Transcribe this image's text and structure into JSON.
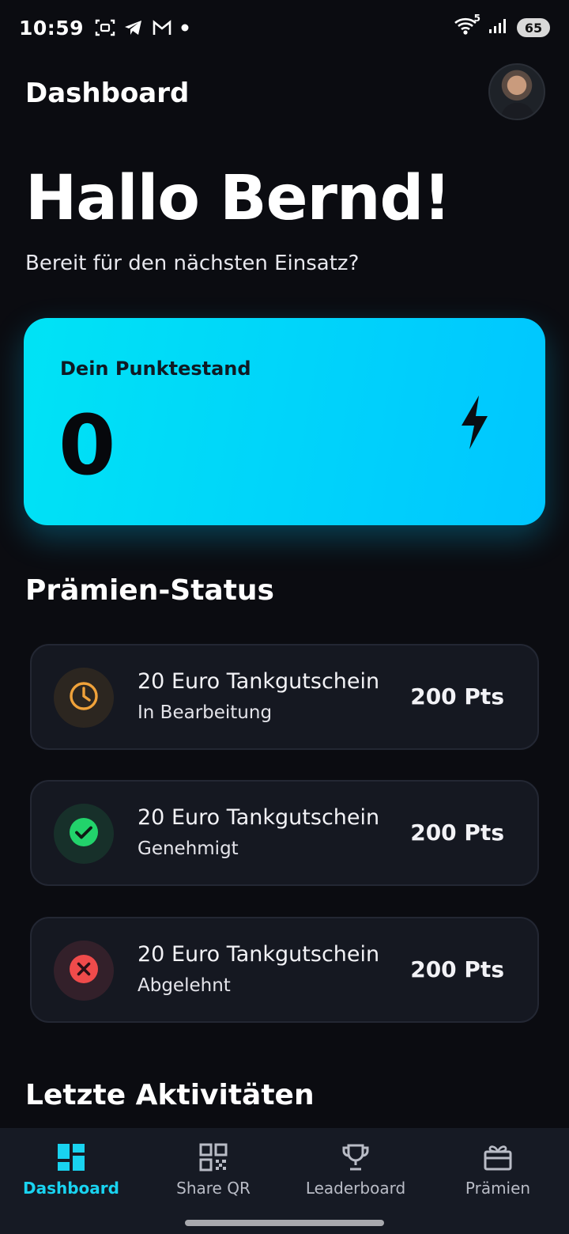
{
  "status_bar": {
    "time": "10:59",
    "battery": "65",
    "wifi_superscript": "5",
    "icons": [
      "screenshot-icon",
      "telegram-icon",
      "gmail-icon",
      "notification-dot-icon",
      "wifi-icon",
      "signal-icon",
      "battery-icon"
    ]
  },
  "header": {
    "title": "Dashboard"
  },
  "greeting": "Hallo Bernd!",
  "subtitle": "Bereit für den nächsten Einsatz?",
  "points_card": {
    "label": "Dein Punktestand",
    "value": "0",
    "icon": "bolt-icon"
  },
  "rewards": {
    "title": "Prämien-Status",
    "items": [
      {
        "name": "20 Euro Tankgutschein",
        "status": "In Bearbeitung",
        "points": "200 Pts",
        "icon": "clock-icon",
        "color": "#f0a23a"
      },
      {
        "name": "20 Euro Tankgutschein",
        "status": "Genehmigt",
        "points": "200 Pts",
        "icon": "check-circle-icon",
        "color": "#22d36b"
      },
      {
        "name": "20 Euro Tankgutschein",
        "status": "Abgelehnt",
        "points": "200 Pts",
        "icon": "x-circle-icon",
        "color": "#ef4b4b"
      }
    ]
  },
  "activity": {
    "title": "Letzte Aktivitäten"
  },
  "nav": {
    "items": [
      {
        "label": "Dashboard",
        "icon": "dashboard-icon",
        "active": true
      },
      {
        "label": "Share QR",
        "icon": "qr-code-icon",
        "active": false
      },
      {
        "label": "Leaderboard",
        "icon": "trophy-icon",
        "active": false
      },
      {
        "label": "Prämien",
        "icon": "gift-icon",
        "active": false
      }
    ]
  },
  "colors": {
    "background": "#0b0c11",
    "accent": "#19d3f0",
    "card_gradient_start": "#00e3f5",
    "card_gradient_end": "#00c6ff",
    "pending": "#f0a23a",
    "approved": "#22d36b",
    "rejected": "#ef4b4b"
  }
}
